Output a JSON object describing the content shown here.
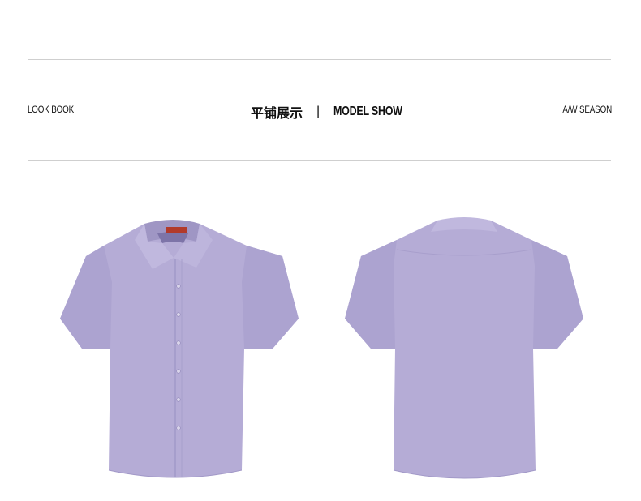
{
  "header": {
    "left_label": "LOOK BOOK",
    "center_cn": "平铺展示",
    "center_sep": "|",
    "center_en": "MODEL SHOW",
    "right_label": "A/W SEASON"
  },
  "colors": {
    "shirt": "#b5acd6",
    "shirt_shade": "#a79ecb",
    "rule": "#cfcfcf",
    "label_tag": "#b23a2b"
  },
  "images": [
    {
      "name": "shirt-front-image",
      "subject": "lavender short-sleeve button-down shirt, front view"
    },
    {
      "name": "shirt-back-image",
      "subject": "lavender short-sleeve button-down shirt, back view"
    }
  ]
}
